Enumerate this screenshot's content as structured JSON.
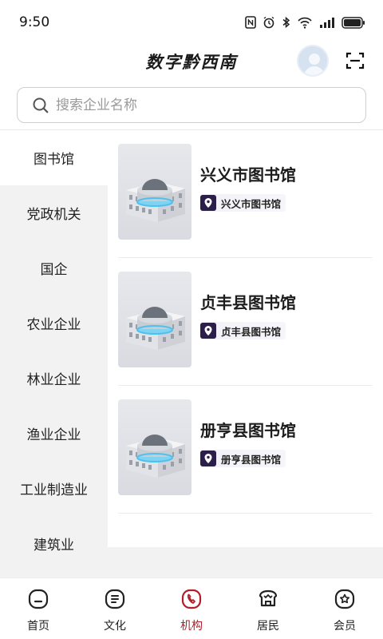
{
  "status_bar": {
    "time": "9:50"
  },
  "header": {
    "title": "数字黔西南"
  },
  "search": {
    "placeholder": "搜索企业名称"
  },
  "sidebar": {
    "items": [
      {
        "label": "图书馆",
        "active": true
      },
      {
        "label": "党政机关"
      },
      {
        "label": "国企"
      },
      {
        "label": "农业企业"
      },
      {
        "label": "林业企业"
      },
      {
        "label": "渔业企业"
      },
      {
        "label": "工业制造业"
      },
      {
        "label": "建筑业"
      }
    ]
  },
  "orgs": [
    {
      "name": "兴义市图书馆",
      "tag": "兴义市图书馆"
    },
    {
      "name": "贞丰县图书馆",
      "tag": "贞丰县图书馆"
    },
    {
      "name": "册亨县图书馆",
      "tag": "册亨县图书馆"
    }
  ],
  "tabbar": {
    "accent": "#b01f2a",
    "items": [
      {
        "label": "首页",
        "icon": "home-icon"
      },
      {
        "label": "文化",
        "icon": "culture-icon"
      },
      {
        "label": "机构",
        "icon": "institution-icon",
        "active": true
      },
      {
        "label": "居民",
        "icon": "residents-icon"
      },
      {
        "label": "会员",
        "icon": "member-icon"
      }
    ]
  }
}
